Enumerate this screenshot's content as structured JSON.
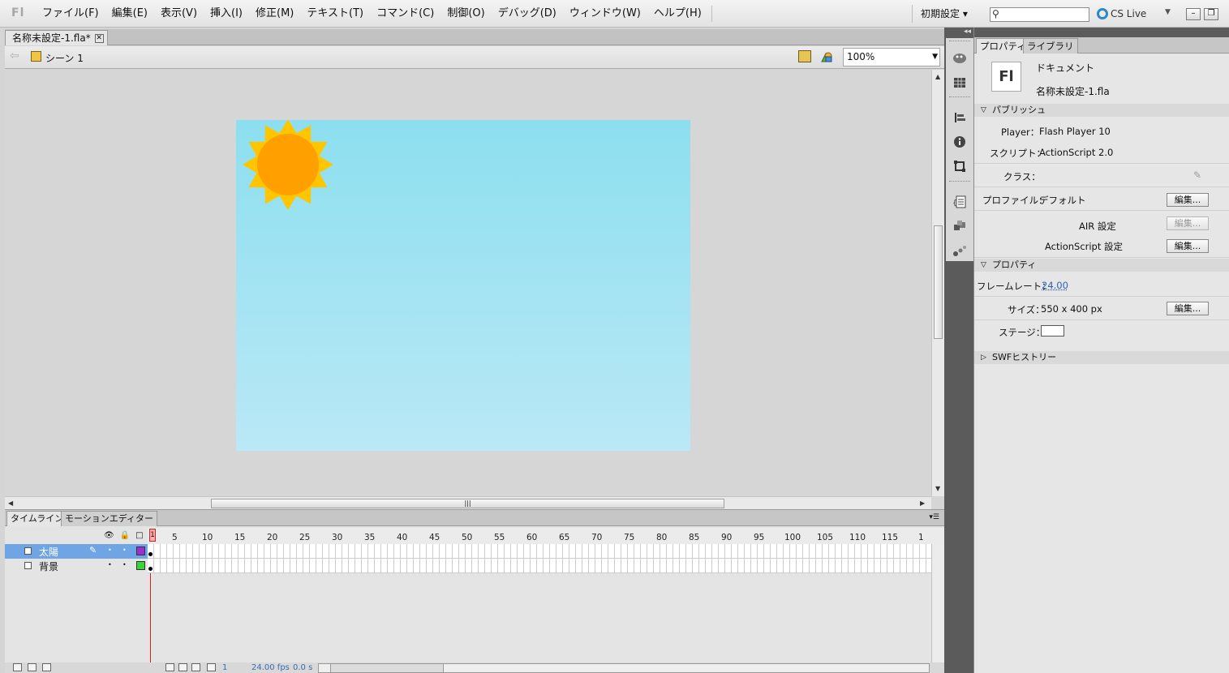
{
  "menubar": {
    "logo": "Fl",
    "items": [
      "ファイル(F)",
      "編集(E)",
      "表示(V)",
      "挿入(I)",
      "修正(M)",
      "テキスト(T)",
      "コマンド(C)",
      "制御(O)",
      "デバッグ(D)",
      "ウィンドウ(W)",
      "ヘルプ(H)"
    ],
    "workspace": "初期設定 ▾",
    "search_placeholder": "",
    "cs_live": "CS Live"
  },
  "document": {
    "tab_title": "名称未設定-1.fla*",
    "scene": "シーン 1",
    "zoom": "100%"
  },
  "timeline": {
    "tabs": [
      "タイムライン",
      "モーションエディター"
    ],
    "ruler_ticks": [
      "5",
      "10",
      "15",
      "20",
      "25",
      "30",
      "35",
      "40",
      "45",
      "50",
      "55",
      "60",
      "65",
      "70",
      "75",
      "80",
      "85",
      "90",
      "95",
      "100",
      "105",
      "110",
      "115",
      "1"
    ],
    "playhead_frame": "1",
    "layers": [
      {
        "name": "太陽",
        "color": "#9c2fd0",
        "selected": true
      },
      {
        "name": "背景",
        "color": "#3ad43a",
        "selected": false
      }
    ],
    "current_frame": "1",
    "fps": "24.00 fps",
    "time": "0.0 s"
  },
  "properties": {
    "tabs": [
      "プロパティ",
      "ライブラリ"
    ],
    "doc_icon": "Fl",
    "doc_type": "ドキュメント",
    "doc_name": "名称未設定-1.fla",
    "publish_header": "パブリッシュ",
    "player_label": "Player：",
    "player_value": "Flash Player 10",
    "script_label": "スクリプト：",
    "script_value": "ActionScript 2.0",
    "class_label": "クラス：",
    "profile_label": "プロファイル：",
    "profile_value": "デフォルト",
    "edit_label": "編集...",
    "air_label": "AIR 設定",
    "as_label": "ActionScript 設定",
    "props_header": "プロパティ",
    "framerate_label": "フレームレート：",
    "framerate_value": "24.00",
    "size_label": "サイズ：",
    "size_value": "550 x 400 px",
    "stage_label": "ステージ：",
    "swf_history": "SWFヒストリー"
  },
  "colors": {
    "stage_top": "#8cdfef",
    "stage_bottom": "#bae8f6",
    "sun_body": "#ff9f00",
    "sun_rays": "#ffc600"
  }
}
